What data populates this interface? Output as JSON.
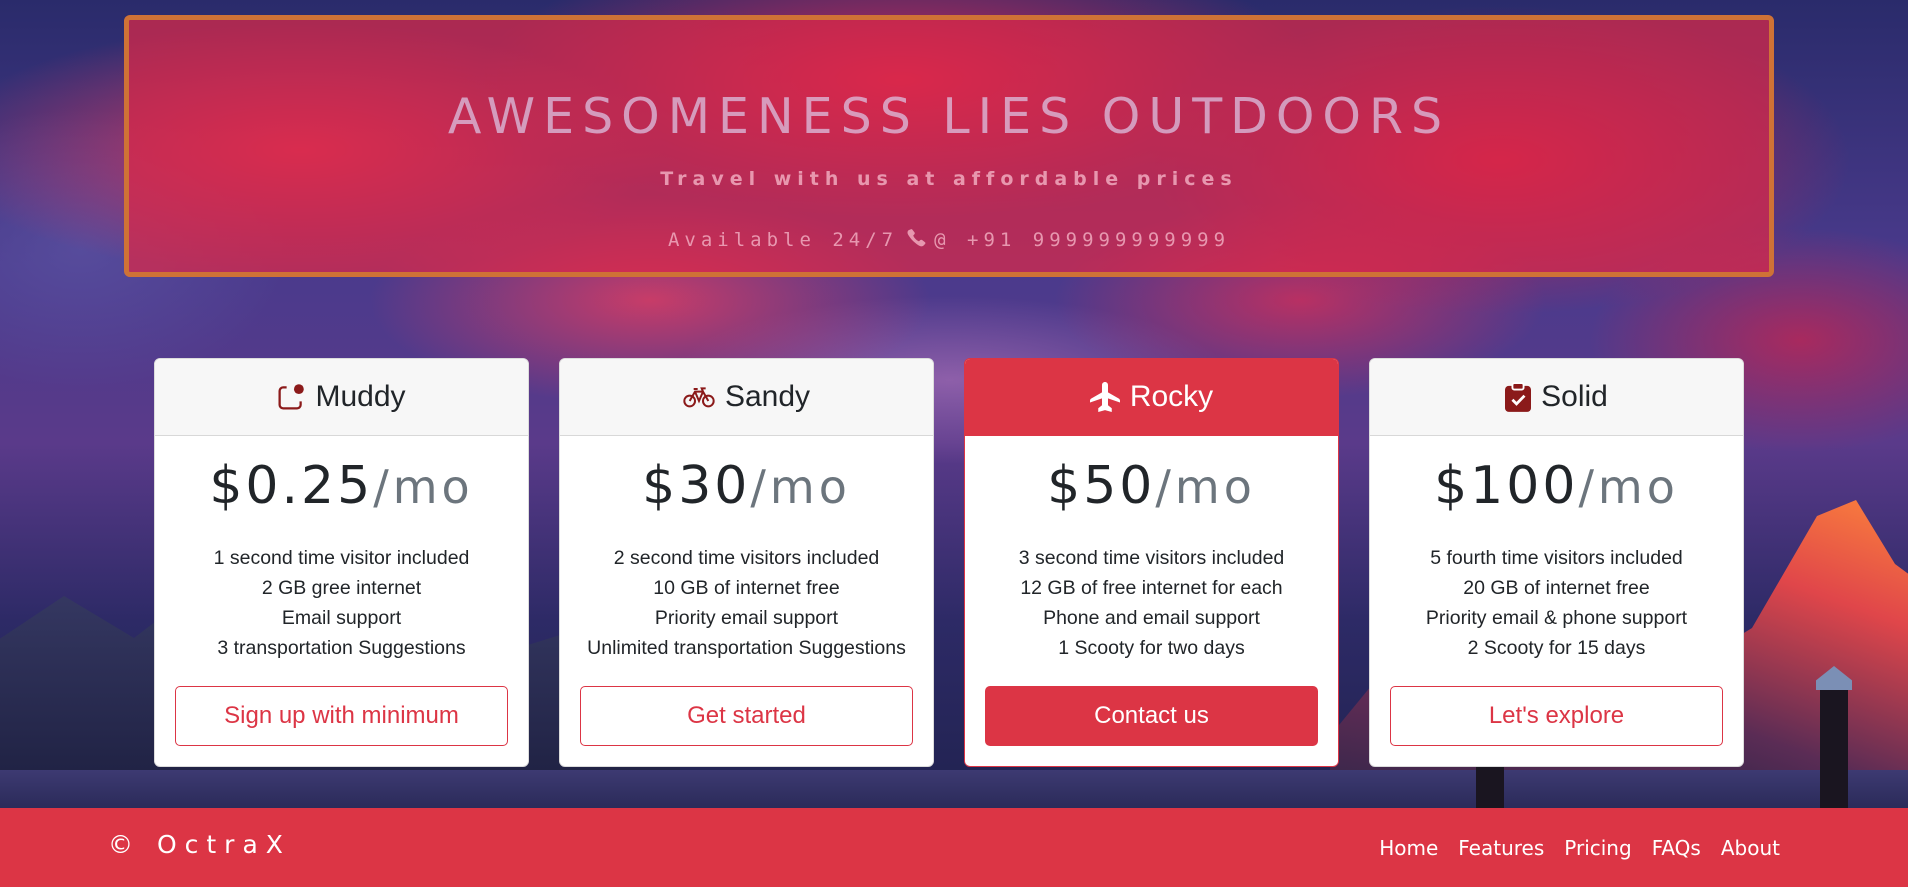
{
  "hero": {
    "title": "AWESOMENESS LIES OUTDOORS",
    "subtitle": "Travel with us at affordable prices",
    "availability": "Available 24/7",
    "phone": "@ +91 999999999999"
  },
  "plans": [
    {
      "name": "Muddy",
      "icon": "app-indicator-icon",
      "price": "$0.25",
      "period": "/mo",
      "features": [
        "1 second time visitor included",
        "2 GB gree internet",
        "Email support",
        "3 transportation Suggestions"
      ],
      "cta": "Sign up with minimum",
      "featured": false
    },
    {
      "name": "Sandy",
      "icon": "bicycle-icon",
      "price": "$30",
      "period": "/mo",
      "features": [
        "2 second time visitors included",
        "10 GB of internet free",
        "Priority email support",
        "Unlimited transportation Suggestions"
      ],
      "cta": "Get started",
      "featured": false
    },
    {
      "name": "Rocky",
      "icon": "airplane-icon",
      "price": "$50",
      "period": "/mo",
      "features": [
        "3 second time visitors included",
        "12 GB of free internet for each",
        "Phone and email support",
        "1 Scooty for two days"
      ],
      "cta": "Contact us",
      "featured": true
    },
    {
      "name": "Solid",
      "icon": "clipboard-check-icon",
      "price": "$100",
      "period": "/mo",
      "features": [
        "5 fourth time visitors included",
        "20 GB of internet free",
        "Priority email & phone support",
        "2 Scooty for 15 days"
      ],
      "cta": "Let's explore",
      "featured": false
    }
  ],
  "footer": {
    "brand": "© OctraX",
    "nav": [
      "Home",
      "Features",
      "Pricing",
      "FAQs",
      "About"
    ]
  },
  "colors": {
    "accent": "#dc3545",
    "hero_border": "#cf7236"
  }
}
